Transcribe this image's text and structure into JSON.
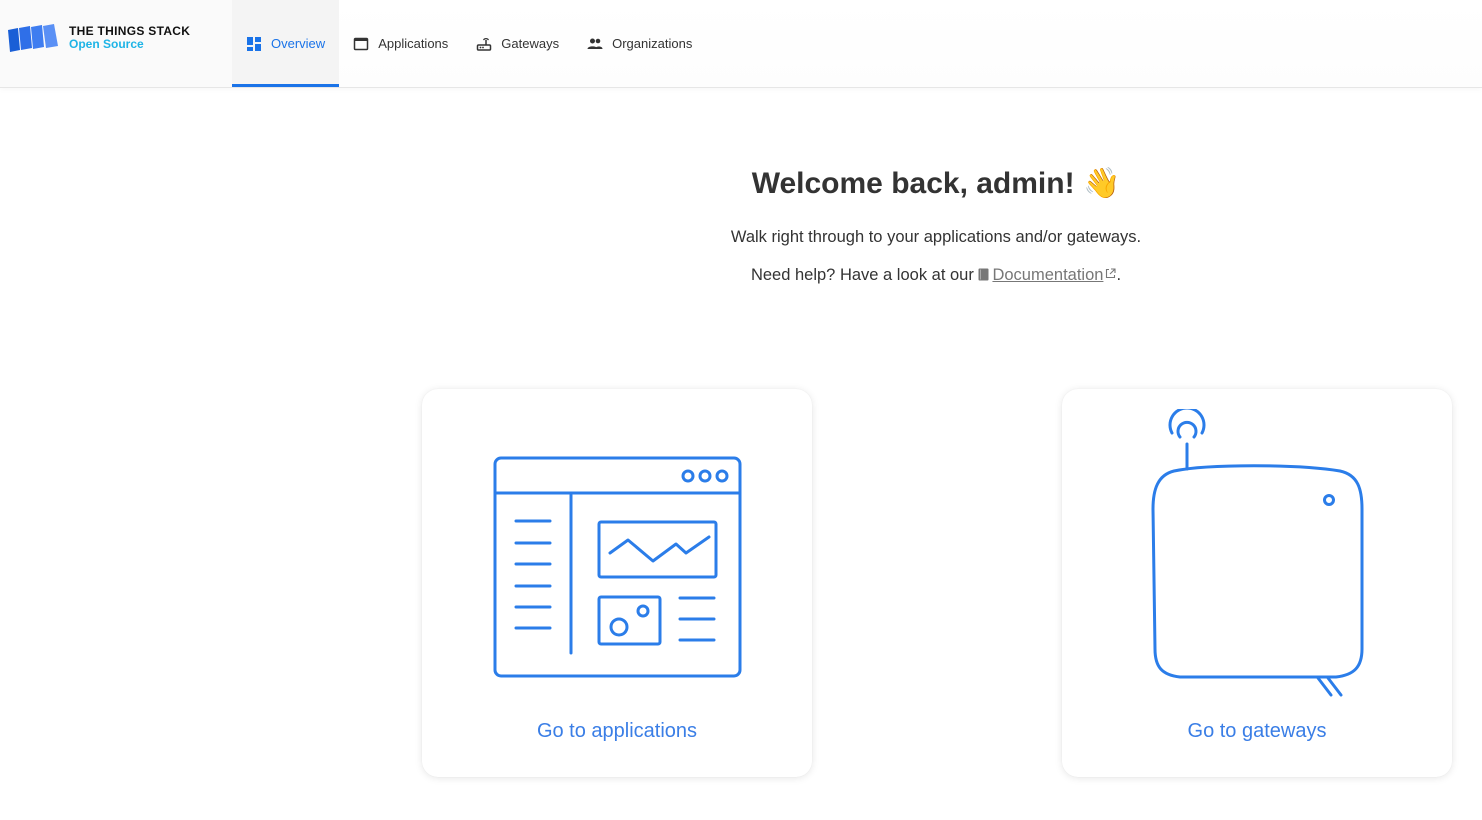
{
  "brand": {
    "title": "THE THINGS STACK",
    "subtitle": "Open Source"
  },
  "nav": {
    "items": [
      {
        "label": "Overview",
        "icon": "dashboard-icon",
        "active": true
      },
      {
        "label": "Applications",
        "icon": "window-icon",
        "active": false
      },
      {
        "label": "Gateways",
        "icon": "router-icon",
        "active": false
      },
      {
        "label": "Organizations",
        "icon": "group-icon",
        "active": false
      }
    ]
  },
  "welcome": {
    "heading": "Welcome back, admin!",
    "emoji": "👋",
    "line1": "Walk right through to your applications and/or gateways.",
    "help_prefix": "Need help? Have a look at our",
    "doc_link": "Documentation",
    "help_suffix": "."
  },
  "cards": {
    "applications": {
      "label": "Go to applications",
      "icon": "application-window-icon"
    },
    "gateways": {
      "label": "Go to gateways",
      "icon": "gateway-device-icon"
    }
  },
  "colors": {
    "accent": "#1a73e8",
    "illustration": "#2b7de9",
    "brand_sub": "#1eb4e6",
    "link": "#777777"
  }
}
